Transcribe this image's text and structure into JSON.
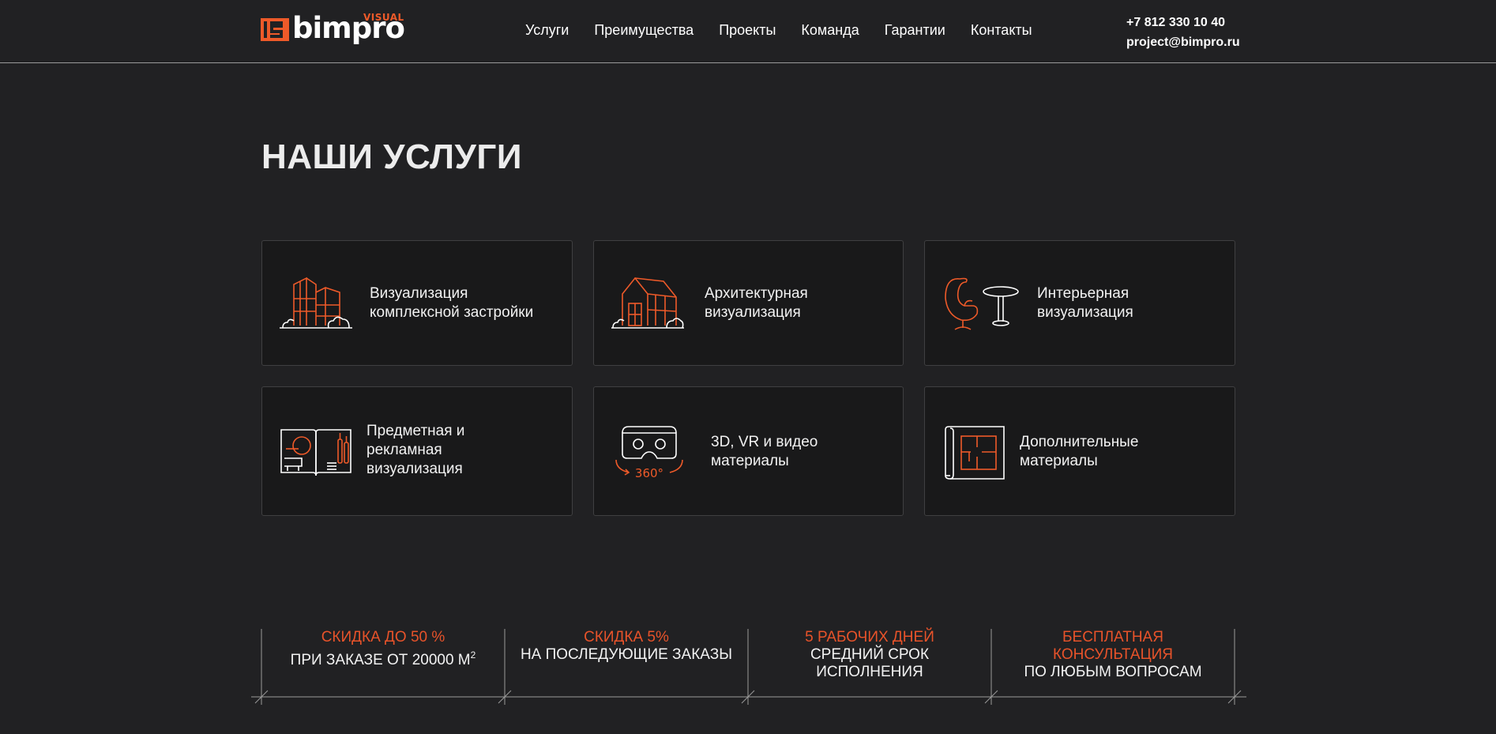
{
  "colors": {
    "background": "#212123",
    "card": "#19191a",
    "accent": "#ee5a29",
    "text": "#ffffff"
  },
  "header": {
    "logo": {
      "text": "bimpro",
      "sub": "VISUAL"
    },
    "nav": [
      "Услуги",
      "Преимущества",
      "Проекты",
      "Команда",
      "Гарантии",
      "Контакты"
    ],
    "phone": "+7 812 330 10 40",
    "email": "project@bimpro.ru"
  },
  "main": {
    "title": "НАШИ УСЛУГИ",
    "services": [
      {
        "label": "Визуализация\nкомплексной застройки",
        "icon": "buildings-icon"
      },
      {
        "label": "Архитектурная\nвизуализация",
        "icon": "house-icon"
      },
      {
        "label": "Интерьерная\nвизуализация",
        "icon": "egg-chair-icon"
      },
      {
        "label": "Предметная и\nрекламная\nвизуализация",
        "icon": "product-book-icon"
      },
      {
        "label": "3D, VR и видео\nматериалы",
        "icon": "vr-headset-icon",
        "icon_caption": "360°"
      },
      {
        "label": "Дополнительные\nматериалы",
        "icon": "floor-plan-icon"
      }
    ]
  },
  "stats": [
    {
      "accent": "СКИДКА ДО 50 %",
      "text": "ПРИ ЗАКАЗЕ ОТ 20000 М",
      "sup": "2"
    },
    {
      "accent": "СКИДКА 5%",
      "text": "НА ПОСЛЕДУЮЩИЕ ЗАКАЗЫ"
    },
    {
      "accent": "5 РАБОЧИХ ДНЕЙ",
      "text": "СРЕДНИЙ СРОК\nИСПОЛНЕНИЯ"
    },
    {
      "accent": "БЕСПЛАТНАЯ\nКОНСУЛЬТАЦИЯ",
      "text": "ПО ЛЮБЫМ ВОПРОСАМ"
    }
  ]
}
